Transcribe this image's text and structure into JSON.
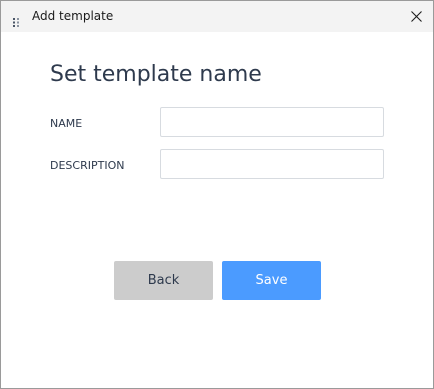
{
  "window": {
    "title": "Add template",
    "icon": "app-grip-icon",
    "close_icon": "close-icon"
  },
  "form": {
    "heading": "Set template name",
    "name_label": "NAME",
    "name_value": "",
    "description_label": "DESCRIPTION",
    "description_value": ""
  },
  "actions": {
    "back_label": "Back",
    "save_label": "Save"
  },
  "colors": {
    "save_button": "#4b9bff",
    "back_button": "#cccccc",
    "heading_text": "#2e3a4d",
    "titlebar": "#f3f3f3"
  }
}
